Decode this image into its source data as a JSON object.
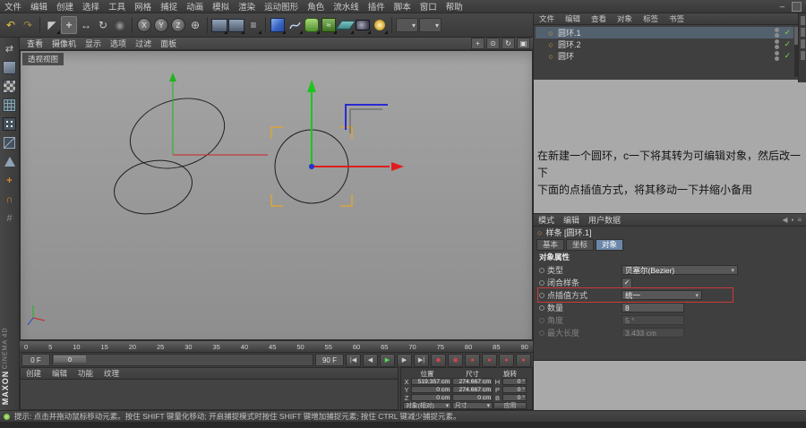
{
  "menubar": {
    "items": [
      "文件",
      "编辑",
      "创建",
      "选择",
      "工具",
      "网格",
      "捕捉",
      "动画",
      "模拟",
      "渲染",
      "运动图形",
      "角色",
      "流水线",
      "插件",
      "脚本",
      "窗口",
      "帮助"
    ],
    "window_minimize": "–"
  },
  "icons": {
    "undo": "↶",
    "redo": "↷",
    "live_selection": "◤",
    "move": "+",
    "scale": "↔",
    "rotate": "↻",
    "last_tool": "◉",
    "lock_x": "X",
    "lock_y": "Y",
    "lock_z": "Z",
    "coord_system": "⊕",
    "render_settings": "≡",
    "modifier": "≈",
    "menu_chevron": "▾",
    "make_editable": "⇄",
    "enable_axis": "+",
    "snap": "∩",
    "workplane_snap": "#",
    "pan_view": "+",
    "zoom_view": "⊙",
    "rotate_view": "↻",
    "maximize_view": "▣",
    "history_back": "◀",
    "lock": "▪",
    "panel_menu": "≡",
    "spline_object": "○"
  },
  "left_toolbar": {
    "items": [
      "make-editable",
      "model-mode",
      "texture-mode",
      "workplane-mode",
      "points-mode",
      "edges-mode",
      "polygons-mode",
      "enable-axis",
      "snap-settings",
      "workplane-snap"
    ]
  },
  "viewport": {
    "menu": [
      "查看",
      "摄像机",
      "显示",
      "选项",
      "过滤",
      "面板"
    ],
    "view_label": "透视视图",
    "colors": {
      "axis_x": "#e01d1d",
      "axis_y": "#1fc41f",
      "plane_handle": "#2a2ad0",
      "selection_bracket": "#dca43a",
      "spline": "#1f1f1f"
    }
  },
  "timeline": {
    "ticks": [
      "0",
      "5",
      "10",
      "15",
      "20",
      "25",
      "30",
      "35",
      "40",
      "45",
      "50",
      "55",
      "60",
      "65",
      "70",
      "75",
      "80",
      "85",
      "90"
    ]
  },
  "transport": {
    "start": "0 F",
    "end": "90 F",
    "handle": "0",
    "buttons": [
      {
        "name": "goto-start",
        "glyph": "|◀"
      },
      {
        "name": "previous-frame",
        "glyph": "◀"
      },
      {
        "name": "play-forwards",
        "glyph": "▶"
      },
      {
        "name": "next-frame",
        "glyph": "▶"
      },
      {
        "name": "goto-end",
        "glyph": "▶|"
      },
      {
        "name": "record-keyframe",
        "glyph": "◆"
      },
      {
        "name": "autokeying",
        "glyph": "◉"
      },
      {
        "name": "record-position",
        "glyph": "●"
      },
      {
        "name": "record-scale",
        "glyph": "●"
      },
      {
        "name": "record-rotation",
        "glyph": "●"
      },
      {
        "name": "record-parameter",
        "glyph": "●"
      }
    ]
  },
  "object_manager": {
    "menu": [
      "文件",
      "编辑",
      "查看",
      "对象",
      "标签",
      "书签"
    ],
    "objects": [
      {
        "name": "圆环.1"
      },
      {
        "name": "圆环.2"
      },
      {
        "name": "圆环"
      }
    ],
    "check_glyph": "✓"
  },
  "annotation": {
    "line1": "在新建一个圆环，c一下将其转为可编辑对象，然后改一下",
    "line2": "下面的点插值方式，将其移动一下并缩小备用"
  },
  "attributes": {
    "menu": [
      "模式",
      "编辑",
      "用户数据"
    ],
    "title": "样条 [圆环.1]",
    "tabs": [
      "基本",
      "坐标",
      "对象"
    ],
    "active_tab": "对象",
    "section": "对象属性",
    "rows": [
      {
        "label": "类型",
        "value": "贝塞尔(Bezier)"
      },
      {
        "label": "闭合样条",
        "value": "✓"
      },
      {
        "label": "点插值方式",
        "value": "统一"
      },
      {
        "label": "数量",
        "value": "8"
      },
      {
        "label": "角度",
        "value": "5 °"
      },
      {
        "label": "最大长度",
        "value": "3.433 cm"
      }
    ],
    "highlight_color": "#cf3a3a"
  },
  "materials": {
    "menu": [
      "创建",
      "编辑",
      "功能",
      "纹理"
    ]
  },
  "coordinates": {
    "headers": [
      "位置",
      "尺寸",
      "旋转"
    ],
    "axis_labels": [
      "X",
      "Y",
      "Z"
    ],
    "rot_labels": [
      "H",
      "P",
      "B"
    ],
    "position": {
      "x": "519.357 cm",
      "y": "0 cm",
      "z": "0 cm"
    },
    "size": {
      "x": "274.667 cm",
      "y": "274.667 cm",
      "z": "0 cm"
    },
    "rotation": {
      "h": "0 °",
      "p": "0 °",
      "b": "0 °"
    },
    "mode1": "对象(相对)",
    "mode2": "尺寸",
    "apply": "应用"
  },
  "statusbar": {
    "hint": "提示: 点击并拖动鼠标移动元素。按住 SHIFT 键量化移动; 开启捕捉模式时按住 SHIFT 键增加捕捉元素; 按住 CTRL 键减少捕捉元素。"
  },
  "branding": {
    "maxon": "MAXON",
    "cinema": "CINEMA 4D"
  }
}
